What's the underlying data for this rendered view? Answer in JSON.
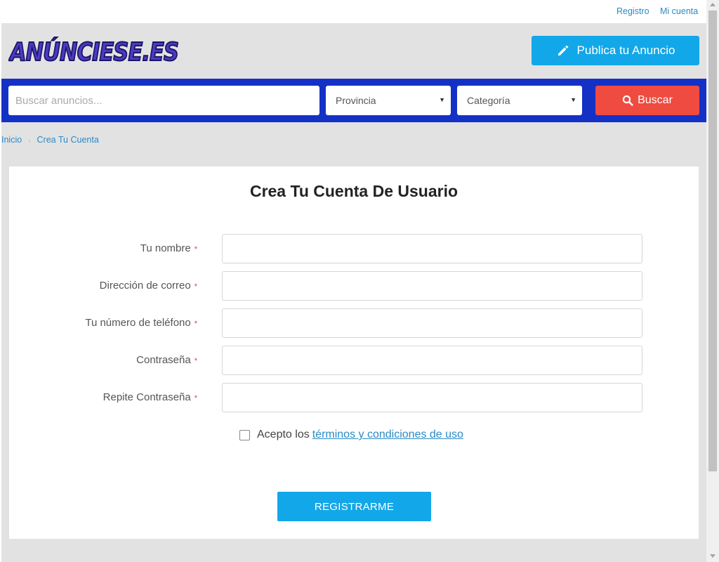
{
  "topbar": {
    "register_link": "Registro",
    "account_link": "Mi cuenta"
  },
  "header": {
    "logo_text": "ANÚNCIESE.ES",
    "publish_label": "Publica tu Anuncio"
  },
  "search": {
    "placeholder": "Buscar anuncios...",
    "province_label": "Provincia",
    "category_label": "Categoría",
    "button_label": "Buscar"
  },
  "breadcrumb": {
    "home": "Inicio",
    "current": "Crea Tu Cuenta"
  },
  "form": {
    "title": "Crea Tu Cuenta De Usuario",
    "fields": [
      {
        "label": "Tu nombre",
        "required_mark": "*",
        "value": ""
      },
      {
        "label": "Dirección de correo",
        "required_mark": "*",
        "value": ""
      },
      {
        "label": "Tu número de teléfono",
        "required_mark": "*",
        "value": ""
      },
      {
        "label": "Contraseña",
        "required_mark": "*",
        "value": ""
      },
      {
        "label": "Repite Contraseña",
        "required_mark": "*",
        "value": ""
      }
    ],
    "terms_text": "Acepto los",
    "terms_link": "términos y condiciones de uso",
    "terms_checked": false,
    "submit_label": "REGISTRARME"
  },
  "colors": {
    "accent_blue": "#12a7e8",
    "search_bar_blue": "#1431c6",
    "search_button_red": "#f04b40",
    "link_blue": "#2a8ac6",
    "logo_purple": "#4b3bc2"
  },
  "icons": {
    "publish": "pencil-icon",
    "search": "search-icon",
    "select_caret": "caret-down-icon"
  }
}
